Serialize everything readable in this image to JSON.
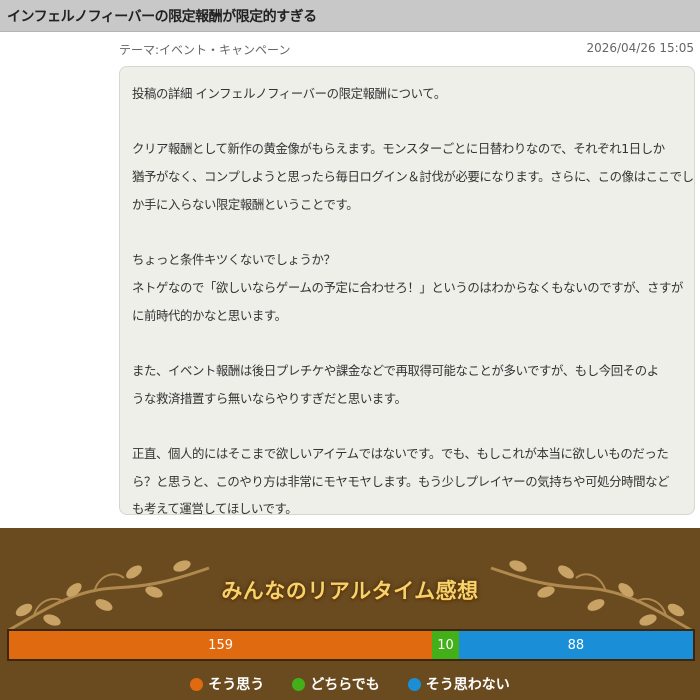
{
  "header": {
    "title": "インフェルノフィーバーの限定報酬が限定的すぎる"
  },
  "post": {
    "theme": "テーマ:イベント・キャンペーン",
    "date": "2026/04/26 15:05",
    "lines": [
      "投稿の詳細 インフェルノフィーバーの限定報酬について。",
      "",
      "クリア報酬として新作の黄金像がもらえます。モンスターごとに日替わりなので、それぞれ1日しか",
      "猶予がなく、コンプしようと思ったら毎日ログイン＆討伐が必要になります。さらに、この像はここでし",
      "か手に入らない限定報酬ということです。",
      "",
      "ちょっと条件キツくないでしょうか？",
      "ネトゲなので「欲しいならゲームの予定に合わせろ！」というのはわからなくもないのですが、さすが",
      "に前時代的かなと思います。",
      "",
      "また、イベント報酬は後日プレチケや課金などで再取得可能なことが多いですが、もし今回そのよ",
      "うな救済措置すら無いならやりすぎだと思います。",
      "",
      "正直、個人的にはそこまで欲しいアイテムではないです。でも、もしこれが本当に欲しいものだった",
      "ら？と思うと、このやり方は非常にモヤモヤします。もう少しプレイヤーの気持ちや可処分時間など",
      "も考えて運営してほしいです。"
    ]
  },
  "poll": {
    "title": "みんなのリアルタイム感想",
    "segments": [
      {
        "key": "yes",
        "value": 159,
        "label": "159",
        "color": "#e06a10"
      },
      {
        "key": "neutral",
        "value": 10,
        "label": "10",
        "color": "#43b01a"
      },
      {
        "key": "no",
        "value": 88,
        "label": "88",
        "color": "#1a8fd8"
      }
    ],
    "legend": [
      {
        "label": "そう思う",
        "color": "#e06a10"
      },
      {
        "label": "どちらでも",
        "color": "#43b01a"
      },
      {
        "label": "そう思わない",
        "color": "#1a8fd8"
      }
    ]
  }
}
